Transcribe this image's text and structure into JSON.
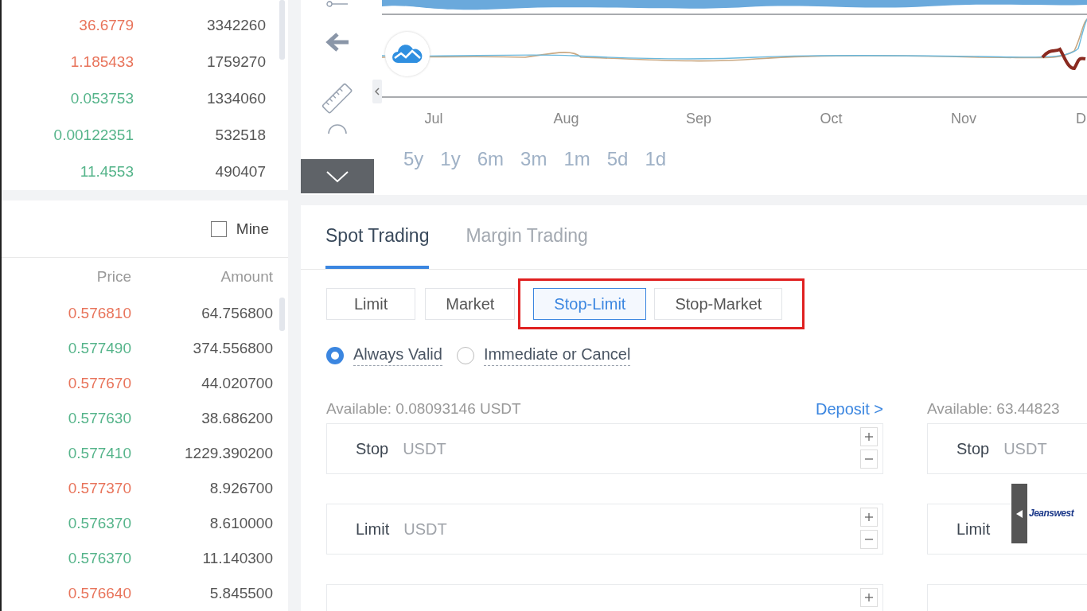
{
  "markets": {
    "rows": [
      {
        "price": "36.6779",
        "volume": "3342260",
        "color": "#e8735a"
      },
      {
        "price": "1.185433",
        "volume": "1759270",
        "color": "#e8735a"
      },
      {
        "price": "0.053753",
        "volume": "1334060",
        "color": "#55b48a"
      },
      {
        "price": "0.00122351",
        "volume": "532518",
        "color": "#55b48a"
      },
      {
        "price": "11.4553",
        "volume": "490407",
        "color": "#55b48a"
      }
    ]
  },
  "trades": {
    "mine": {
      "label": "Mine",
      "checked": false
    },
    "columns": [
      "Price",
      "Amount"
    ],
    "rows": [
      {
        "price": "0.576810",
        "amount": "64.756800",
        "color": "#e8735a"
      },
      {
        "price": "0.577490",
        "amount": "374.556800",
        "color": "#55b48a"
      },
      {
        "price": "0.577670",
        "amount": "44.020700",
        "color": "#e8735a"
      },
      {
        "price": "0.577630",
        "amount": "38.686200",
        "color": "#55b48a"
      },
      {
        "price": "0.577410",
        "amount": "1229.390200",
        "color": "#55b48a"
      },
      {
        "price": "0.577370",
        "amount": "8.926700",
        "color": "#e8735a"
      },
      {
        "price": "0.576370",
        "amount": "8.610000",
        "color": "#55b48a"
      },
      {
        "price": "0.576370",
        "amount": "11.140300",
        "color": "#55b48a"
      },
      {
        "price": "0.576640",
        "amount": "5.845500",
        "color": "#e8735a"
      }
    ]
  },
  "chart": {
    "toolbar_expanded": false,
    "months": [
      "Jul",
      "Aug",
      "Sep",
      "Oct",
      "Nov",
      "D"
    ],
    "ranges": [
      "5y",
      "1y",
      "6m",
      "3m",
      "1m",
      "5d",
      "1d"
    ]
  },
  "order": {
    "tabs": [
      {
        "label": "Spot Trading",
        "selected": true
      },
      {
        "label": "Margin Trading",
        "selected": false
      }
    ],
    "types": [
      {
        "label": "Limit",
        "selected": false,
        "outlined": false
      },
      {
        "label": "Market",
        "selected": false,
        "outlined": false
      },
      {
        "label": "Stop-Limit",
        "selected": true,
        "outlined": true
      },
      {
        "label": "Stop-Market",
        "selected": false,
        "outlined": true
      }
    ],
    "validity": [
      {
        "label": "Always Valid",
        "selected": true
      },
      {
        "label": "Immediate or Cancel",
        "selected": false
      }
    ],
    "forms": [
      {
        "available": "Available: 0.08093146 USDT",
        "link": "Deposit >",
        "fields": [
          {
            "kind": "full",
            "label": "Stop",
            "unit": "USDT",
            "steppers": true
          },
          {
            "kind": "full",
            "label": "Limit",
            "unit": "USDT",
            "steppers": true
          },
          {
            "kind": "partial",
            "steppers": true
          }
        ]
      },
      {
        "available": "Available: 63.44823",
        "fields": [
          {
            "kind": "full",
            "label": "Stop",
            "unit": "USDT"
          },
          {
            "kind": "full",
            "label": "Limit"
          },
          {
            "kind": "partial"
          }
        ]
      }
    ]
  },
  "ad": {
    "text": "Jeanswest"
  }
}
